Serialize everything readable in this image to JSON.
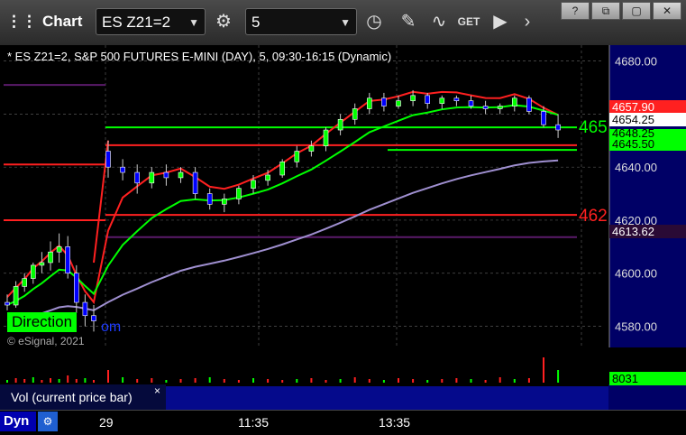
{
  "toolbar": {
    "title": "Chart",
    "symbol": "ES Z21=2",
    "interval": "5",
    "window_buttons": [
      "?",
      "⧉",
      "▢",
      "✕"
    ]
  },
  "chart_title": "* ES Z21=2, S&P 500 FUTURES E-MINI (DAY), 5, 09:30-16:15 (Dynamic)",
  "direction_label": "Direction",
  "direction_tail": "om",
  "copyright": "© eSignal, 2021",
  "volume_label": "Vol (current price bar)",
  "volume_close": "×",
  "dyn_label": "Dyn",
  "time_labels": [
    "29",
    "11:35",
    "13:35"
  ],
  "price_boxes": {
    "red_top": "4657.90",
    "white": "4654.25",
    "green_mid": "4648.25",
    "green_low": "4645.50",
    "purple": "4613.62",
    "volume": "8031"
  },
  "line_labels": {
    "green": "465",
    "red": "462"
  },
  "colors": {
    "up": "#00ff00",
    "down": "#0000ff",
    "red": "#ff2020",
    "green": "#00ff00",
    "purple": "#9f8fd0",
    "dark_purple": "#5a1a6a"
  },
  "chart_data": {
    "type": "candlestick",
    "title": "ES Z21=2, S&P 500 FUTURES E-MINI (DAY), 5, 09:30-16:15 (Dynamic)",
    "y_ticks": [
      4580,
      4600,
      4620,
      4640,
      4660,
      4680
    ],
    "ylim": [
      4572,
      4686
    ],
    "x_tick_labels": [
      "29",
      "11:35",
      "13:35"
    ],
    "levels": [
      {
        "name": "red",
        "value": 4657.9
      },
      {
        "name": "green_upper",
        "value": 4655
      },
      {
        "name": "green_mid",
        "value": 4648.25
      },
      {
        "name": "green_low",
        "value": 4645.5
      },
      {
        "name": "red_lower",
        "value": 4622
      },
      {
        "name": "purple",
        "value": 4613.62
      }
    ],
    "candles": [
      [
        4589,
        4592,
        4586,
        4588
      ],
      [
        4588,
        4597,
        4587,
        4595
      ],
      [
        4595,
        4600,
        4593,
        4598
      ],
      [
        4598,
        4604,
        4596,
        4603
      ],
      [
        4603,
        4608,
        4600,
        4604
      ],
      [
        4604,
        4612,
        4601,
        4608
      ],
      [
        4608,
        4615,
        4604,
        4610
      ],
      [
        4610,
        4614,
        4598,
        4600
      ],
      [
        4600,
        4603,
        4585,
        4589
      ],
      [
        4589,
        4592,
        4580,
        4584
      ],
      [
        4584,
        4588,
        4578,
        4582
      ],
      [
        4646,
        4650,
        4636,
        4640
      ],
      [
        4640,
        4643,
        4635,
        4638
      ],
      [
        4638,
        4641,
        4630,
        4634
      ],
      [
        4634,
        4640,
        4632,
        4638
      ],
      [
        4638,
        4641,
        4633,
        4636
      ],
      [
        4636,
        4640,
        4634,
        4638
      ],
      [
        4638,
        4640,
        4628,
        4630
      ],
      [
        4630,
        4632,
        4624,
        4626
      ],
      [
        4626,
        4630,
        4623,
        4628
      ],
      [
        4628,
        4633,
        4626,
        4632
      ],
      [
        4632,
        4637,
        4630,
        4635
      ],
      [
        4635,
        4639,
        4633,
        4637
      ],
      [
        4637,
        4643,
        4636,
        4642
      ],
      [
        4642,
        4648,
        4640,
        4646
      ],
      [
        4646,
        4650,
        4644,
        4648
      ],
      [
        4648,
        4655,
        4646,
        4654
      ],
      [
        4654,
        4660,
        4652,
        4658
      ],
      [
        4658,
        4664,
        4656,
        4662
      ],
      [
        4662,
        4668,
        4660,
        4666
      ],
      [
        4666,
        4668,
        4661,
        4663
      ],
      [
        4663,
        4667,
        4662,
        4665
      ],
      [
        4665,
        4669,
        4663,
        4667
      ],
      [
        4667,
        4668,
        4662,
        4664
      ],
      [
        4664,
        4667,
        4662,
        4666
      ],
      [
        4666,
        4667,
        4663,
        4665
      ],
      [
        4665,
        4667,
        4662,
        4663
      ],
      [
        4663,
        4665,
        4660,
        4662
      ],
      [
        4662,
        4664,
        4660,
        4663
      ],
      [
        4663,
        4667,
        4661,
        4666
      ],
      [
        4666,
        4667,
        4660,
        4661
      ],
      [
        4661,
        4663,
        4655,
        4656
      ],
      [
        4656,
        4660,
        4651,
        4654
      ]
    ]
  }
}
